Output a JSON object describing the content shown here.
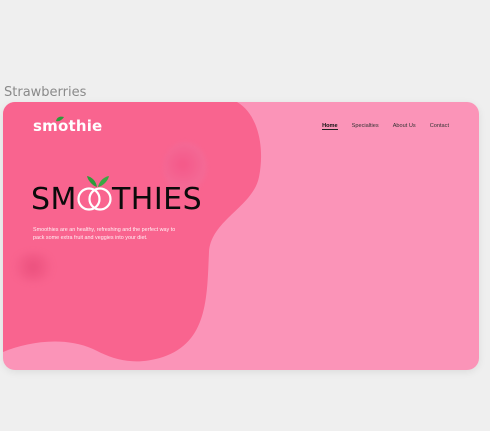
{
  "frame": {
    "label": "Strawberries"
  },
  "header": {
    "logo": "smothie",
    "nav": [
      "Home",
      "Specialties",
      "About Us",
      "Contact"
    ]
  },
  "hero": {
    "headline_before": "SM",
    "headline_after": "THIES",
    "description": "Smoothies are an healthy, refreshing and the perfect way to pack some extra fruit and veggies into your diet."
  },
  "colors": {
    "background": "#fb94b8",
    "blob": "#f9648f",
    "text_dark": "#0b0b0b",
    "leaf": "#2e9b3a"
  }
}
